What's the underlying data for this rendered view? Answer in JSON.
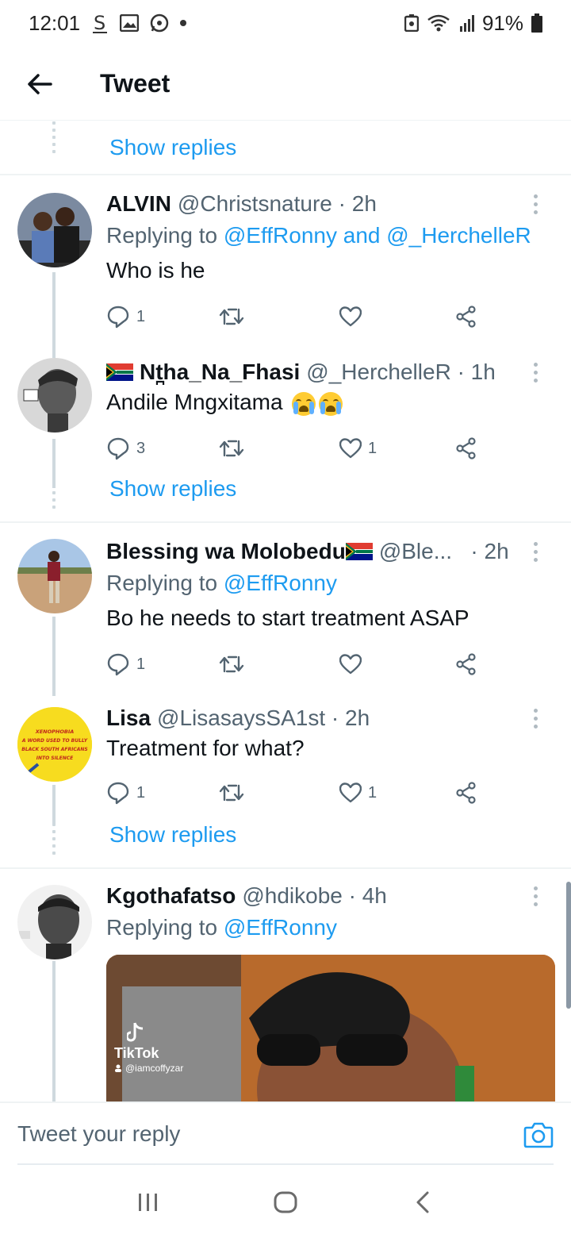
{
  "status_bar": {
    "time": "12:01",
    "battery": "91%"
  },
  "header": {
    "title": "Tweet"
  },
  "show_replies_label": "Show replies",
  "tweets": [
    {
      "name": "ALVIN",
      "handle": "@Christsnature",
      "time": "· 2h",
      "reply_prefix": "Replying to",
      "reply_mentions": "@EffRonny and @_HerchelleR",
      "text": "Who is he",
      "replies": "1",
      "retweets": "",
      "likes": ""
    },
    {
      "name": "Nt̪ha_Na_Fhasi",
      "handle": "@_HerchelleR",
      "time": "· 1h",
      "text": "Andile Mngxitama",
      "replies": "3",
      "retweets": "",
      "likes": "1"
    },
    {
      "name": "Blessing wa Molobedu",
      "handle": "@Ble...",
      "time": "· 2h",
      "reply_prefix": "Replying to",
      "reply_mentions": "@EffRonny",
      "text": "Bo he needs to start treatment ASAP",
      "replies": "1",
      "retweets": "",
      "likes": ""
    },
    {
      "name": "Lisa",
      "handle": "@LisasaysSA1st",
      "time": "· 2h",
      "text": "Treatment for what?",
      "replies": "1",
      "retweets": "",
      "likes": "1",
      "avatar_text": [
        "XENOPHOBIA",
        "A WORD USED TO BULLY",
        "BLACK SOUTH AFRICANS",
        "INTO SILENCE"
      ]
    },
    {
      "name": "Kgothafatso",
      "handle": "@hdikobe",
      "time": "· 4h",
      "reply_prefix": "Replying to",
      "reply_mentions": "@EffRonny",
      "media_label": "TikTok",
      "media_user": "@iamcoffyzar"
    }
  ],
  "reply_bar": {
    "placeholder": "Tweet your reply"
  },
  "colors": {
    "accent": "#1d9bf0",
    "text": "#0f1419",
    "muted": "#536471"
  }
}
